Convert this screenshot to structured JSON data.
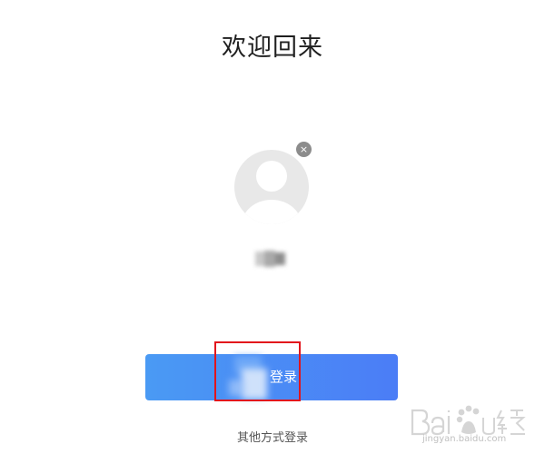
{
  "header": {
    "title": "欢迎回来"
  },
  "account": {
    "avatar_icon": "default-user-avatar-icon",
    "remove_icon": "close-icon",
    "remove_glyph": "×",
    "username": ""
  },
  "actions": {
    "login_label": "登录",
    "other_login_label": "其他方式登录"
  },
  "annotation": {
    "highlight_color": "#e2151c"
  },
  "colors": {
    "button_gradient_start": "#4a9af4",
    "button_gradient_end": "#4b7df6",
    "avatar_bg": "#e8e8e8"
  },
  "watermark": {
    "logo": "Bai du 经验",
    "url": "jingyan.baidu.com"
  }
}
